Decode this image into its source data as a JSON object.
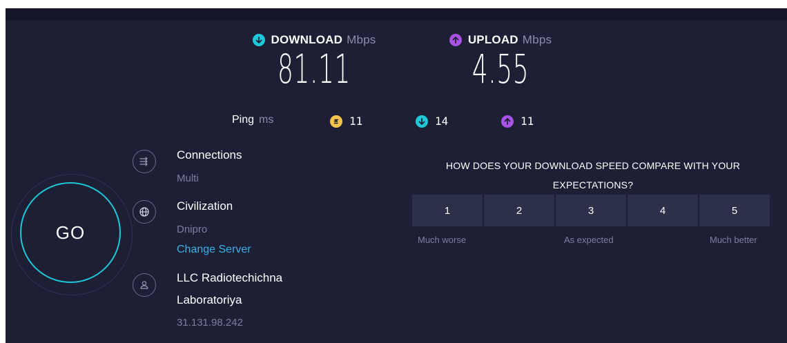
{
  "download": {
    "label": "DOWNLOAD",
    "unit": "Mbps",
    "value": "81.11",
    "icon": "arrow-down-circle-icon",
    "color": "#1fc8d8"
  },
  "upload": {
    "label": "UPLOAD",
    "unit": "Mbps",
    "value": "4.55",
    "icon": "arrow-up-circle-icon",
    "color": "#a653e6"
  },
  "ping": {
    "label": "Ping",
    "unit": "ms",
    "idle": {
      "value": "11",
      "icon": "ping-icon",
      "color": "#f2c44a"
    },
    "download": {
      "value": "14",
      "icon": "arrow-down-circle-icon",
      "color": "#1fc8d8"
    },
    "upload": {
      "value": "11",
      "icon": "arrow-up-circle-icon",
      "color": "#a653e6"
    }
  },
  "go_button": {
    "label": "GO"
  },
  "connections": {
    "title": "Connections",
    "value": "Multi",
    "icon": "connections-icon"
  },
  "server": {
    "title": "Civilization",
    "location": "Dnipro",
    "change_link": "Change Server",
    "icon": "globe-icon"
  },
  "provider": {
    "name_line1": "LLC Radiotechichna",
    "name_line2": "Laboratoriya",
    "ip": "31.131.98.242",
    "icon": "user-icon"
  },
  "survey": {
    "question_line1": "HOW DOES YOUR DOWNLOAD SPEED COMPARE WITH YOUR",
    "question_line2": "EXPECTATIONS?",
    "options": [
      "1",
      "2",
      "3",
      "4",
      "5"
    ],
    "label_low": "Much worse",
    "label_mid": "As expected",
    "label_high": "Much better"
  }
}
